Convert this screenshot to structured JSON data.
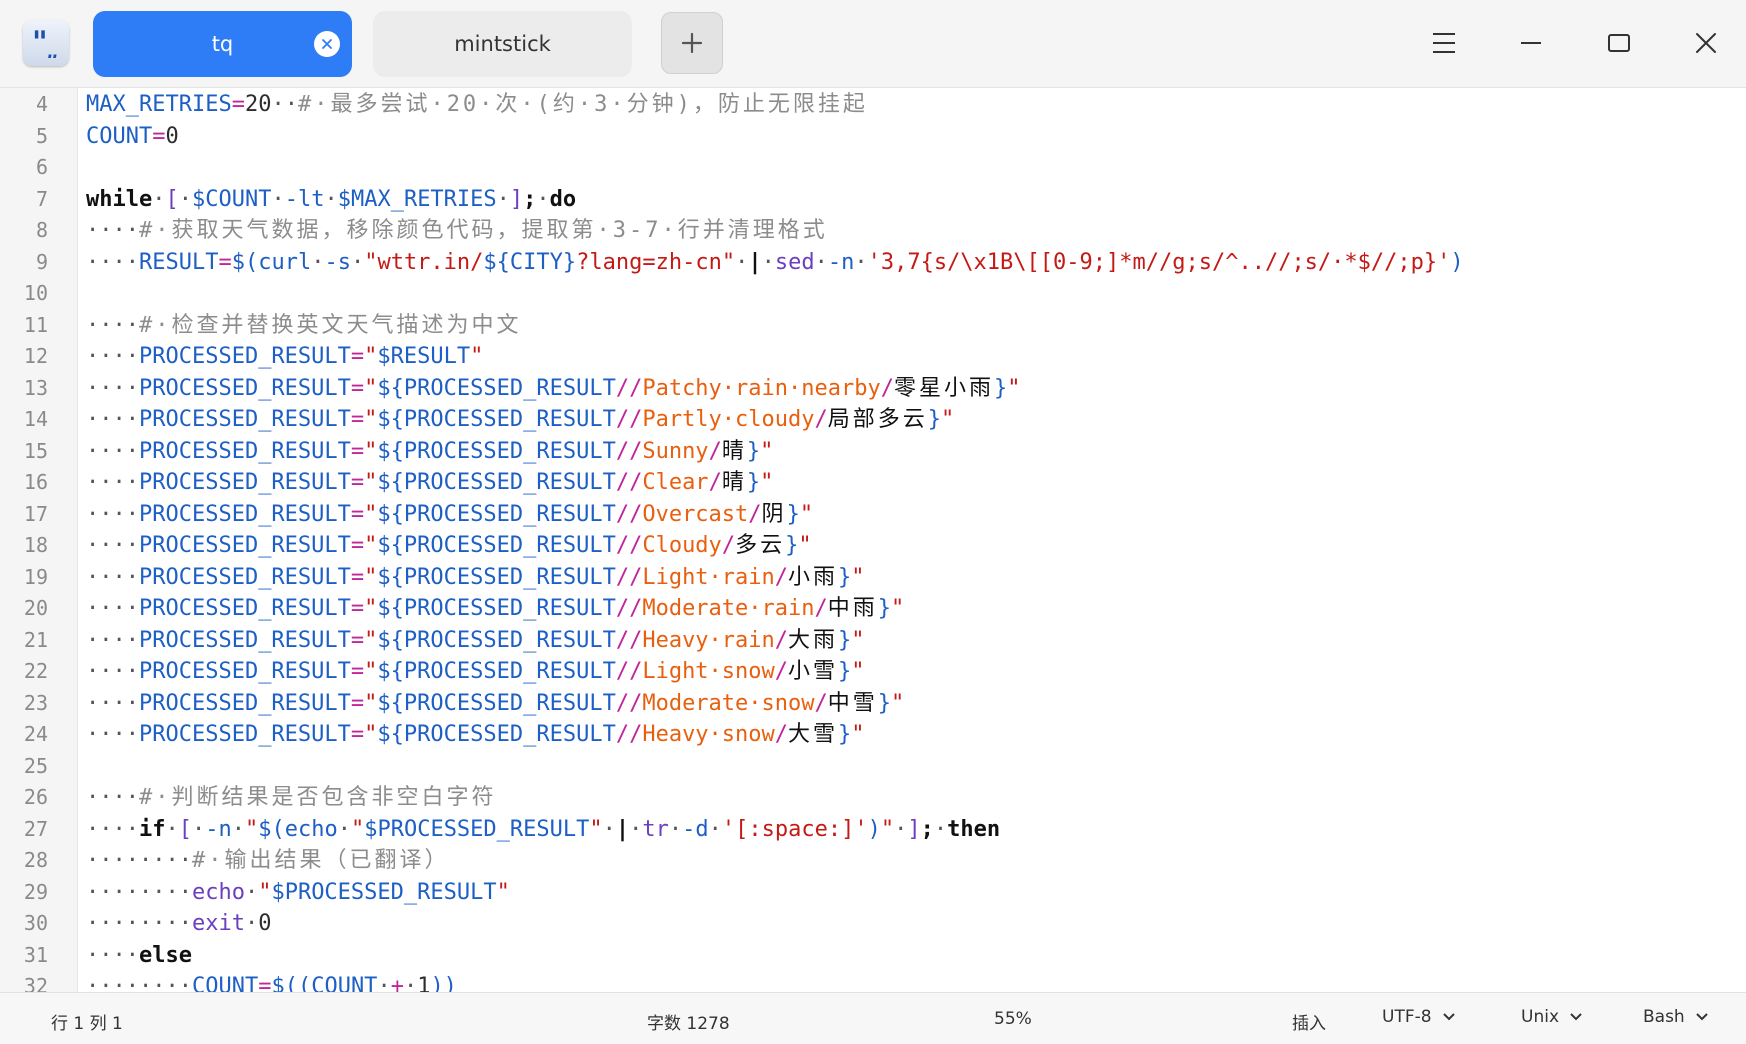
{
  "window": {
    "tabs": [
      {
        "label": "tq",
        "active": true
      },
      {
        "label": "mintstick",
        "active": false
      }
    ],
    "accent_color": "#2e7cf6"
  },
  "editor": {
    "lines": [
      {
        "num": "4",
        "tokens": [
          [
            "v",
            "MAX_RETRIES"
          ],
          [
            "o",
            "="
          ],
          [
            "n",
            "20"
          ],
          [
            "ws",
            "··"
          ],
          [
            "c",
            "#·最多尝试·20·次·(约·3·分钟)，防止无限挂起"
          ]
        ]
      },
      {
        "num": "5",
        "tokens": [
          [
            "v",
            "COUNT"
          ],
          [
            "o",
            "="
          ],
          [
            "n",
            "0"
          ]
        ]
      },
      {
        "num": "6",
        "tokens": []
      },
      {
        "num": "7",
        "tokens": [
          [
            "k",
            "while"
          ],
          [
            "ws",
            "·"
          ],
          [
            "b",
            "["
          ],
          [
            "ws",
            "·"
          ],
          [
            "v",
            "$COUNT"
          ],
          [
            "ws",
            "·"
          ],
          [
            "v",
            "-lt"
          ],
          [
            "ws",
            "·"
          ],
          [
            "v",
            "$MAX_RETRIES"
          ],
          [
            "ws",
            "·"
          ],
          [
            "b",
            "]"
          ],
          [
            "k",
            ";"
          ],
          [
            "ws",
            "·"
          ],
          [
            "k",
            "do"
          ]
        ]
      },
      {
        "num": "8",
        "tokens": [
          [
            "ws",
            "····"
          ],
          [
            "c",
            "#·获取天气数据，移除颜色代码，提取第·3-7·行并清理格式"
          ]
        ]
      },
      {
        "num": "9",
        "tokens": [
          [
            "ws",
            "····"
          ],
          [
            "v",
            "RESULT"
          ],
          [
            "o",
            "="
          ],
          [
            "v",
            "$("
          ],
          [
            "cmd",
            "curl"
          ],
          [
            "ws",
            "·"
          ],
          [
            "v",
            "-s"
          ],
          [
            "ws",
            "·"
          ],
          [
            "s",
            "\"wttr.in/"
          ],
          [
            "v",
            "${CITY}"
          ],
          [
            "s",
            "?lang=zh-cn\""
          ],
          [
            "ws",
            "·"
          ],
          [
            "k",
            "|"
          ],
          [
            "ws",
            "·"
          ],
          [
            "b",
            "sed"
          ],
          [
            "ws",
            "·"
          ],
          [
            "v",
            "-n"
          ],
          [
            "ws",
            "·"
          ],
          [
            "s",
            "'3,7{s/\\x1B\\[[0-9;]*m//g;s/^..//;s/·*$//;p}'"
          ],
          [
            "v",
            ")"
          ]
        ]
      },
      {
        "num": "10",
        "tokens": []
      },
      {
        "num": "11",
        "tokens": [
          [
            "ws",
            "····"
          ],
          [
            "c",
            "#·检查并替换英文天气描述为中文"
          ]
        ]
      },
      {
        "num": "12",
        "tokens": [
          [
            "ws",
            "····"
          ],
          [
            "v",
            "PROCESSED_RESULT"
          ],
          [
            "o",
            "="
          ],
          [
            "s",
            "\""
          ],
          [
            "v",
            "$RESULT"
          ],
          [
            "s",
            "\""
          ]
        ]
      },
      {
        "num": "13",
        "tokens": [
          [
            "ws",
            "····"
          ],
          [
            "v",
            "PROCESSED_RESULT"
          ],
          [
            "o",
            "="
          ],
          [
            "s",
            "\""
          ],
          [
            "v",
            "${PROCESSED_RESULT"
          ],
          [
            "o",
            "//"
          ],
          [
            "r",
            "Patchy·rain·nearby"
          ],
          [
            "o",
            "/"
          ],
          [
            "zh",
            "零星小雨"
          ],
          [
            "v",
            "}"
          ],
          [
            "s",
            "\""
          ]
        ]
      },
      {
        "num": "14",
        "tokens": [
          [
            "ws",
            "····"
          ],
          [
            "v",
            "PROCESSED_RESULT"
          ],
          [
            "o",
            "="
          ],
          [
            "s",
            "\""
          ],
          [
            "v",
            "${PROCESSED_RESULT"
          ],
          [
            "o",
            "//"
          ],
          [
            "r",
            "Partly·cloudy"
          ],
          [
            "o",
            "/"
          ],
          [
            "zh",
            "局部多云"
          ],
          [
            "v",
            "}"
          ],
          [
            "s",
            "\""
          ]
        ]
      },
      {
        "num": "15",
        "tokens": [
          [
            "ws",
            "····"
          ],
          [
            "v",
            "PROCESSED_RESULT"
          ],
          [
            "o",
            "="
          ],
          [
            "s",
            "\""
          ],
          [
            "v",
            "${PROCESSED_RESULT"
          ],
          [
            "o",
            "//"
          ],
          [
            "r",
            "Sunny"
          ],
          [
            "o",
            "/"
          ],
          [
            "zh",
            "晴"
          ],
          [
            "v",
            "}"
          ],
          [
            "s",
            "\""
          ]
        ]
      },
      {
        "num": "16",
        "tokens": [
          [
            "ws",
            "····"
          ],
          [
            "v",
            "PROCESSED_RESULT"
          ],
          [
            "o",
            "="
          ],
          [
            "s",
            "\""
          ],
          [
            "v",
            "${PROCESSED_RESULT"
          ],
          [
            "o",
            "//"
          ],
          [
            "r",
            "Clear"
          ],
          [
            "o",
            "/"
          ],
          [
            "zh",
            "晴"
          ],
          [
            "v",
            "}"
          ],
          [
            "s",
            "\""
          ]
        ]
      },
      {
        "num": "17",
        "tokens": [
          [
            "ws",
            "····"
          ],
          [
            "v",
            "PROCESSED_RESULT"
          ],
          [
            "o",
            "="
          ],
          [
            "s",
            "\""
          ],
          [
            "v",
            "${PROCESSED_RESULT"
          ],
          [
            "o",
            "//"
          ],
          [
            "r",
            "Overcast"
          ],
          [
            "o",
            "/"
          ],
          [
            "zh",
            "阴"
          ],
          [
            "v",
            "}"
          ],
          [
            "s",
            "\""
          ]
        ]
      },
      {
        "num": "18",
        "tokens": [
          [
            "ws",
            "····"
          ],
          [
            "v",
            "PROCESSED_RESULT"
          ],
          [
            "o",
            "="
          ],
          [
            "s",
            "\""
          ],
          [
            "v",
            "${PROCESSED_RESULT"
          ],
          [
            "o",
            "//"
          ],
          [
            "r",
            "Cloudy"
          ],
          [
            "o",
            "/"
          ],
          [
            "zh",
            "多云"
          ],
          [
            "v",
            "}"
          ],
          [
            "s",
            "\""
          ]
        ]
      },
      {
        "num": "19",
        "tokens": [
          [
            "ws",
            "····"
          ],
          [
            "v",
            "PROCESSED_RESULT"
          ],
          [
            "o",
            "="
          ],
          [
            "s",
            "\""
          ],
          [
            "v",
            "${PROCESSED_RESULT"
          ],
          [
            "o",
            "//"
          ],
          [
            "r",
            "Light·rain"
          ],
          [
            "o",
            "/"
          ],
          [
            "zh",
            "小雨"
          ],
          [
            "v",
            "}"
          ],
          [
            "s",
            "\""
          ]
        ]
      },
      {
        "num": "20",
        "tokens": [
          [
            "ws",
            "····"
          ],
          [
            "v",
            "PROCESSED_RESULT"
          ],
          [
            "o",
            "="
          ],
          [
            "s",
            "\""
          ],
          [
            "v",
            "${PROCESSED_RESULT"
          ],
          [
            "o",
            "//"
          ],
          [
            "r",
            "Moderate·rain"
          ],
          [
            "o",
            "/"
          ],
          [
            "zh",
            "中雨"
          ],
          [
            "v",
            "}"
          ],
          [
            "s",
            "\""
          ]
        ]
      },
      {
        "num": "21",
        "tokens": [
          [
            "ws",
            "····"
          ],
          [
            "v",
            "PROCESSED_RESULT"
          ],
          [
            "o",
            "="
          ],
          [
            "s",
            "\""
          ],
          [
            "v",
            "${PROCESSED_RESULT"
          ],
          [
            "o",
            "//"
          ],
          [
            "r",
            "Heavy·rain"
          ],
          [
            "o",
            "/"
          ],
          [
            "zh",
            "大雨"
          ],
          [
            "v",
            "}"
          ],
          [
            "s",
            "\""
          ]
        ]
      },
      {
        "num": "22",
        "tokens": [
          [
            "ws",
            "····"
          ],
          [
            "v",
            "PROCESSED_RESULT"
          ],
          [
            "o",
            "="
          ],
          [
            "s",
            "\""
          ],
          [
            "v",
            "${PROCESSED_RESULT"
          ],
          [
            "o",
            "//"
          ],
          [
            "r",
            "Light·snow"
          ],
          [
            "o",
            "/"
          ],
          [
            "zh",
            "小雪"
          ],
          [
            "v",
            "}"
          ],
          [
            "s",
            "\""
          ]
        ]
      },
      {
        "num": "23",
        "tokens": [
          [
            "ws",
            "····"
          ],
          [
            "v",
            "PROCESSED_RESULT"
          ],
          [
            "o",
            "="
          ],
          [
            "s",
            "\""
          ],
          [
            "v",
            "${PROCESSED_RESULT"
          ],
          [
            "o",
            "//"
          ],
          [
            "r",
            "Moderate·snow"
          ],
          [
            "o",
            "/"
          ],
          [
            "zh",
            "中雪"
          ],
          [
            "v",
            "}"
          ],
          [
            "s",
            "\""
          ]
        ]
      },
      {
        "num": "24",
        "tokens": [
          [
            "ws",
            "····"
          ],
          [
            "v",
            "PROCESSED_RESULT"
          ],
          [
            "o",
            "="
          ],
          [
            "s",
            "\""
          ],
          [
            "v",
            "${PROCESSED_RESULT"
          ],
          [
            "o",
            "//"
          ],
          [
            "r",
            "Heavy·snow"
          ],
          [
            "o",
            "/"
          ],
          [
            "zh",
            "大雪"
          ],
          [
            "v",
            "}"
          ],
          [
            "s",
            "\""
          ]
        ]
      },
      {
        "num": "25",
        "tokens": []
      },
      {
        "num": "26",
        "tokens": [
          [
            "ws",
            "····"
          ],
          [
            "c",
            "#·判断结果是否包含非空白字符"
          ]
        ]
      },
      {
        "num": "27",
        "tokens": [
          [
            "ws",
            "····"
          ],
          [
            "k",
            "if"
          ],
          [
            "ws",
            "·"
          ],
          [
            "b",
            "["
          ],
          [
            "ws",
            "·"
          ],
          [
            "v",
            "-n"
          ],
          [
            "ws",
            "·"
          ],
          [
            "s",
            "\""
          ],
          [
            "v",
            "$("
          ],
          [
            "cmd",
            "echo"
          ],
          [
            "ws",
            "·"
          ],
          [
            "s",
            "\""
          ],
          [
            "v",
            "$PROCESSED_RESULT"
          ],
          [
            "s",
            "\""
          ],
          [
            "ws",
            "·"
          ],
          [
            "k",
            "|"
          ],
          [
            "ws",
            "·"
          ],
          [
            "b",
            "tr"
          ],
          [
            "ws",
            "·"
          ],
          [
            "v",
            "-d"
          ],
          [
            "ws",
            "·"
          ],
          [
            "s",
            "'[:space:]'"
          ],
          [
            "v",
            ")"
          ],
          [
            "s",
            "\""
          ],
          [
            "ws",
            "·"
          ],
          [
            "b",
            "]"
          ],
          [
            "k",
            ";"
          ],
          [
            "ws",
            "·"
          ],
          [
            "k",
            "then"
          ]
        ]
      },
      {
        "num": "28",
        "tokens": [
          [
            "ws",
            "········"
          ],
          [
            "c",
            "#·输出结果（已翻译）"
          ]
        ]
      },
      {
        "num": "29",
        "tokens": [
          [
            "ws",
            "········"
          ],
          [
            "b",
            "echo"
          ],
          [
            "ws",
            "·"
          ],
          [
            "s",
            "\""
          ],
          [
            "v",
            "$PROCESSED_RESULT"
          ],
          [
            "s",
            "\""
          ]
        ]
      },
      {
        "num": "30",
        "tokens": [
          [
            "ws",
            "········"
          ],
          [
            "b",
            "exit"
          ],
          [
            "ws",
            "·"
          ],
          [
            "n",
            "0"
          ]
        ]
      },
      {
        "num": "31",
        "tokens": [
          [
            "ws",
            "····"
          ],
          [
            "k",
            "else"
          ]
        ]
      },
      {
        "num": "32",
        "tokens": [
          [
            "ws",
            "········"
          ],
          [
            "v",
            "COUNT"
          ],
          [
            "o",
            "="
          ],
          [
            "v",
            "$(("
          ],
          [
            "v",
            "COUNT"
          ],
          [
            "ws",
            "·"
          ],
          [
            "o",
            "+"
          ],
          [
            "ws",
            "·"
          ],
          [
            "n",
            "1"
          ],
          [
            "v",
            "))"
          ]
        ]
      }
    ]
  },
  "statusbar": {
    "position": "行 1 列 1",
    "char_count": "字数 1278",
    "zoom": "55%",
    "insert_mode": "插入",
    "encoding": "UTF-8",
    "line_ending": "Unix",
    "language": "Bash"
  }
}
